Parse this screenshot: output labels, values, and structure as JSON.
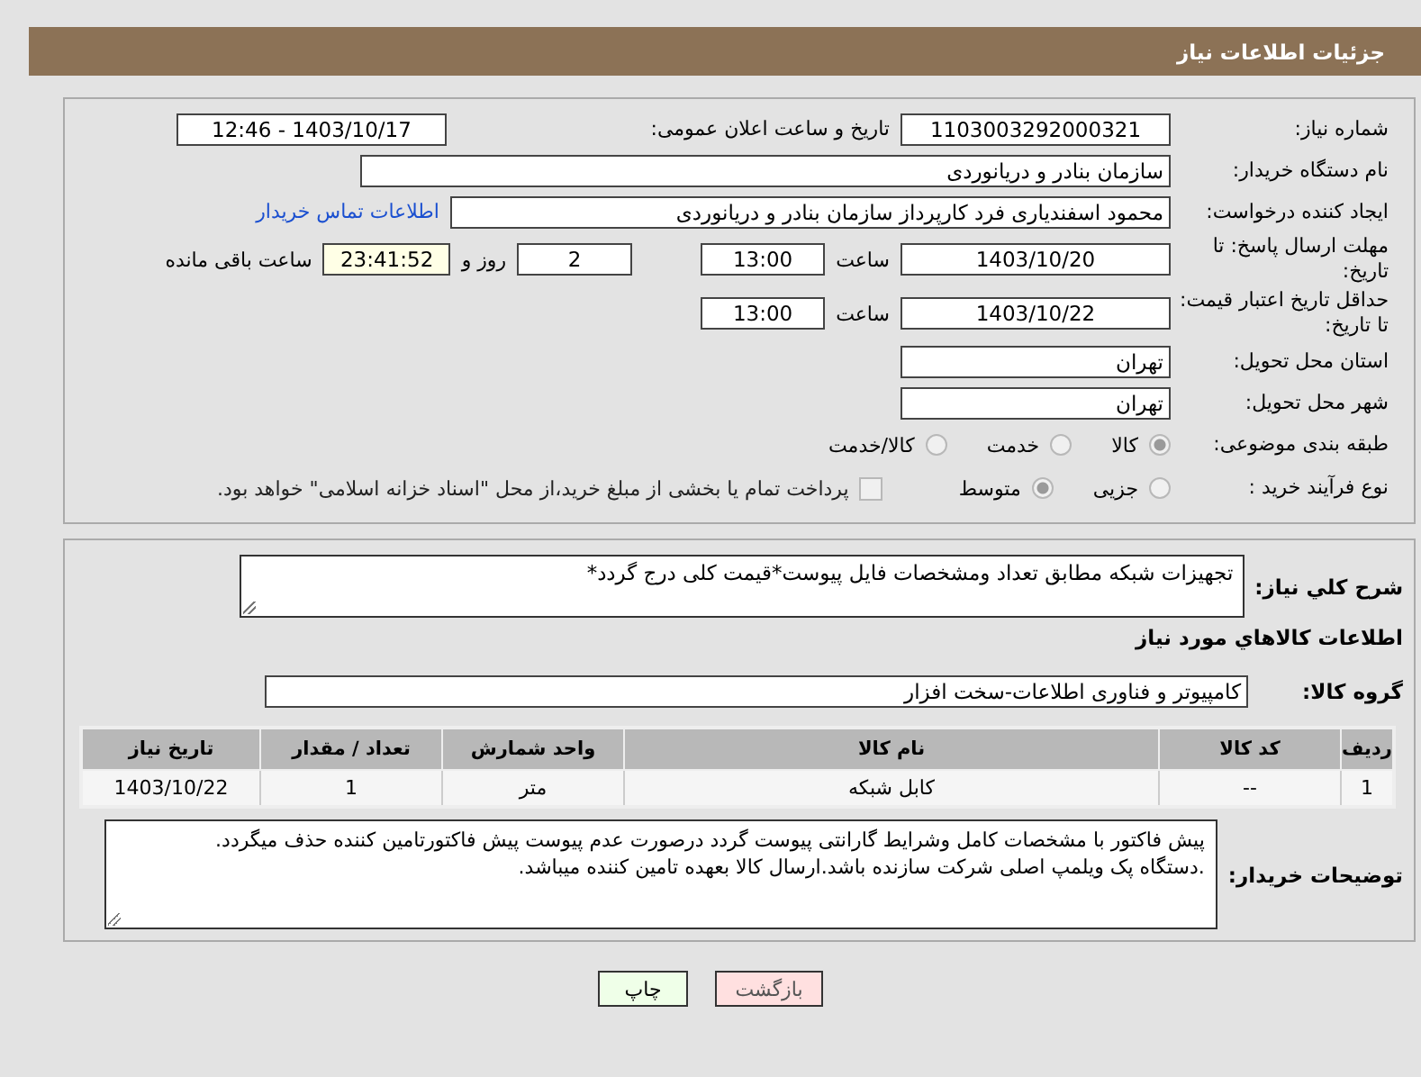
{
  "header": {
    "title": "جزئیات اطلاعات نیاز"
  },
  "need_number": {
    "label": "شماره نیاز:",
    "value": "1103003292000321"
  },
  "announce": {
    "label": "تاریخ و ساعت اعلان عمومی:",
    "value": "1403/10/17 - 12:46"
  },
  "buyer_org": {
    "label": "نام دستگاه خریدار:",
    "value": "سازمان بنادر و دریانوردی"
  },
  "requester": {
    "label": "ایجاد کننده درخواست:",
    "value": "محمود اسفندیاری فرد کارپرداز سازمان بنادر و دریانوردی",
    "link": "اطلاعات تماس خریدار"
  },
  "reply_deadline": {
    "label": "مهلت ارسال پاسخ: تا تاریخ:",
    "date": "1403/10/20",
    "time_label": "ساعت",
    "time": "13:00",
    "days": "2",
    "days_label": "روز و",
    "remaining": "23:41:52",
    "remaining_label": "ساعت باقی مانده"
  },
  "price_validity": {
    "label": "حداقل تاریخ اعتبار قیمت: تا تاریخ:",
    "date": "1403/10/22",
    "time_label": "ساعت",
    "time": "13:00"
  },
  "province": {
    "label": "استان محل تحویل:",
    "value": "تهران"
  },
  "city": {
    "label": "شهر محل تحویل:",
    "value": "تهران"
  },
  "category": {
    "label": "طبقه بندی موضوعی:",
    "options": [
      {
        "label": "کالا",
        "selected": true
      },
      {
        "label": "خدمت",
        "selected": false
      },
      {
        "label": "کالا/خدمت",
        "selected": false
      }
    ]
  },
  "purchase_type": {
    "label": "نوع فرآیند خرید :",
    "options": [
      {
        "label": "جزیی",
        "selected": false
      },
      {
        "label": "متوسط",
        "selected": true
      }
    ],
    "payment": {
      "checked": false,
      "text": "پرداخت تمام یا بخشی از مبلغ خرید،از محل \"اسناد خزانه اسلامی\" خواهد بود."
    }
  },
  "description": {
    "label": "شرح کلي نیاز:",
    "value": "تجهیزات شبکه مطابق تعداد ومشخصات فایل پیوست*قیمت کلی درج گردد*"
  },
  "goods_heading": "اطلاعات کالاهاي مورد نياز",
  "goods_group": {
    "label": "گروه کالا:",
    "value": "کامپیوتر و فناوری اطلاعات-سخت افزار"
  },
  "table": {
    "columns": [
      "ردیف",
      "کد کالا",
      "نام کالا",
      "واحد شمارش",
      "تعداد / مقدار",
      "تاریخ نیاز"
    ],
    "rows": [
      [
        "1",
        "--",
        "کابل شبکه",
        "متر",
        "1",
        "1403/10/22"
      ]
    ]
  },
  "buyer_notes": {
    "label": "توضیحات خریدار:",
    "lines": [
      "پیش فاکتور با مشخصات کامل وشرایط گارانتی پیوست گردد درصورت عدم پیوست پیش فاکتورتامین کننده حذف میگردد.",
      ".دستگاه پک ویلمپ اصلی شرکت سازنده باشد.ارسال کالا بعهده تامین کننده میباشد."
    ]
  },
  "buttons": [
    {
      "label": "بازگشت",
      "kind": "back"
    },
    {
      "label": "چاپ",
      "kind": "print"
    }
  ]
}
